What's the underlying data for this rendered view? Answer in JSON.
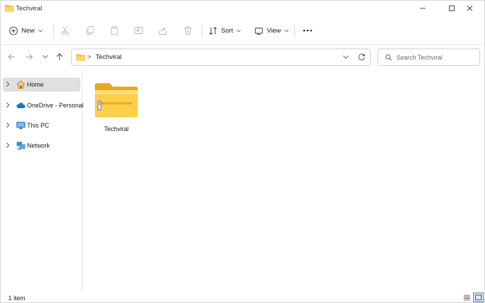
{
  "window": {
    "title": "Techviral"
  },
  "toolbar": {
    "new_label": "New",
    "sort_label": "Sort",
    "view_label": "View"
  },
  "address": {
    "crumbs": [
      "Techviral"
    ],
    "separator": ">"
  },
  "search": {
    "placeholder": "Search Techviral"
  },
  "sidebar": {
    "items": [
      {
        "label": "Home",
        "icon": "home-icon",
        "selected": true
      },
      {
        "label": "OneDrive - Personal",
        "icon": "cloud-icon",
        "selected": false
      },
      {
        "label": "This PC",
        "icon": "computer-icon",
        "selected": false
      },
      {
        "label": "Network",
        "icon": "network-icon",
        "selected": false
      }
    ]
  },
  "content": {
    "items": [
      {
        "name": "Techviral",
        "icon": "zip-folder-icon"
      }
    ]
  },
  "status": {
    "count": "1 item"
  },
  "colors": {
    "folder": "#f4c042",
    "selected": "#e0e0e0",
    "accent": "#0067c0"
  }
}
